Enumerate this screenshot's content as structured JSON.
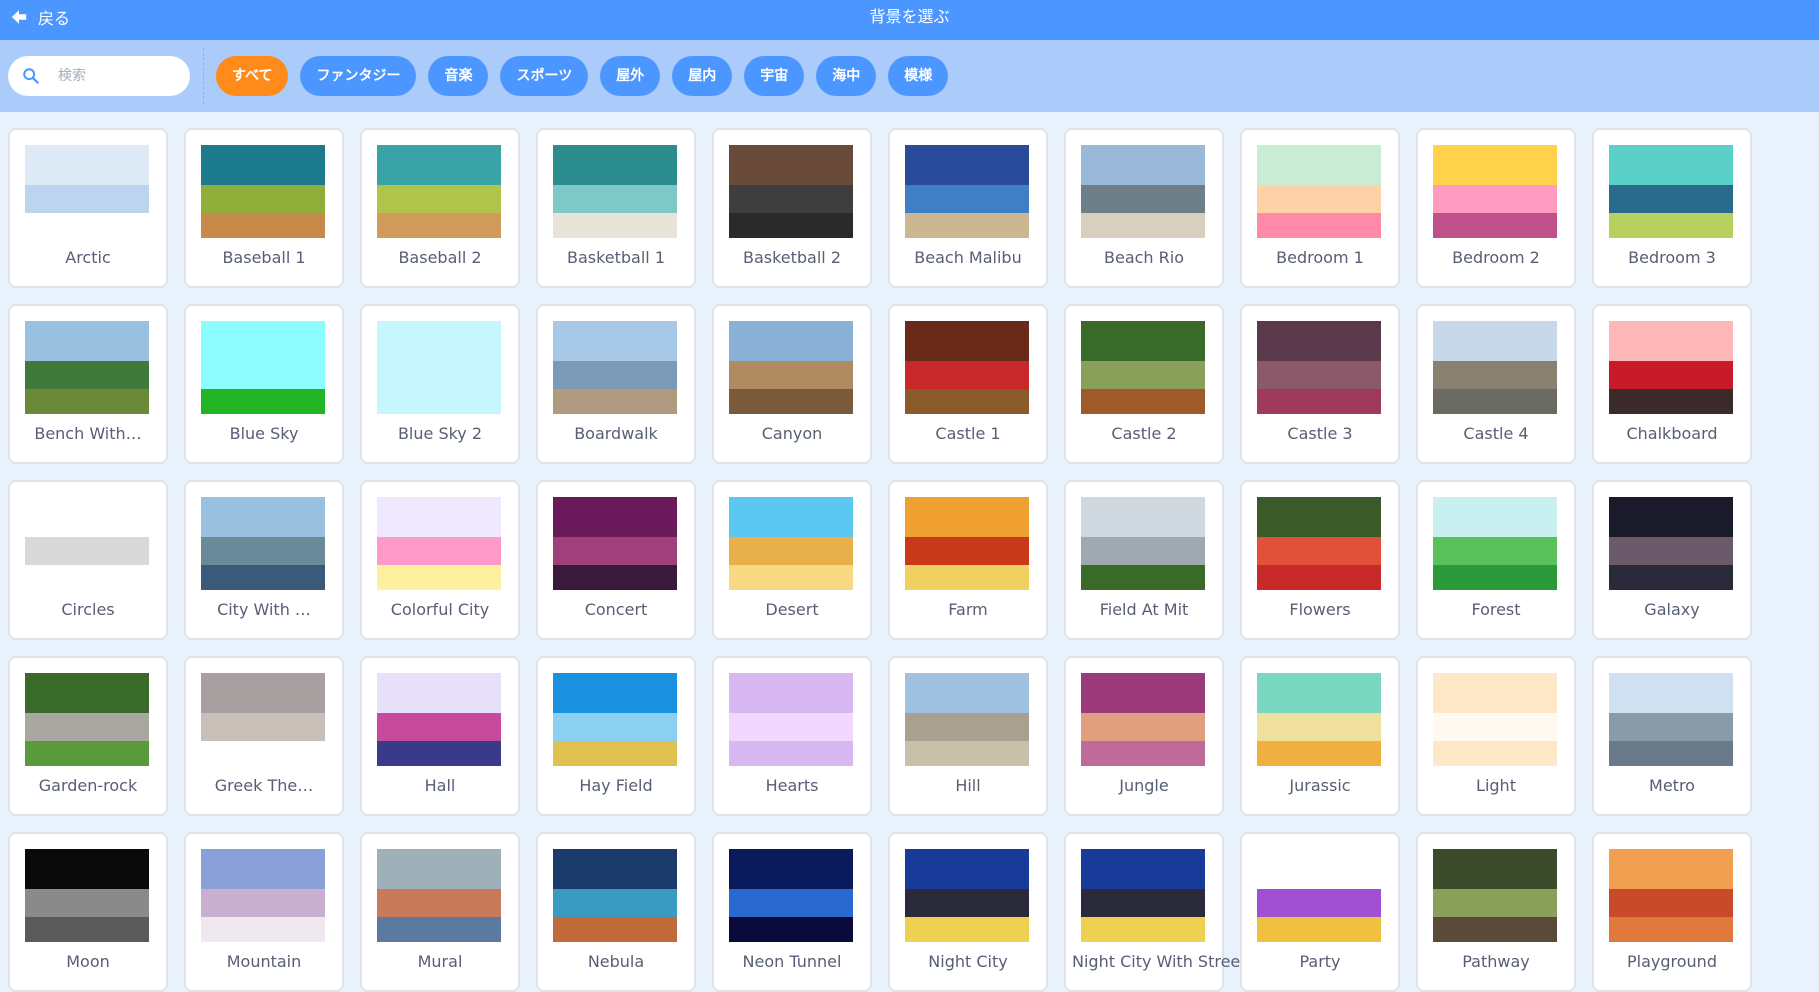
{
  "header": {
    "back_label": "戻る",
    "title": "背景を選ぶ"
  },
  "search": {
    "placeholder": "検索",
    "value": ""
  },
  "tags": [
    "すべて",
    "ファンタジー",
    "音楽",
    "スポーツ",
    "屋外",
    "屋内",
    "宇宙",
    "海中",
    "模様"
  ],
  "active_tag": 0,
  "colors": {
    "header": "#4c97ff",
    "filter_bar": "#abcbfa",
    "tag": "#4c97ff",
    "tag_active": "#ff8c1a",
    "background": "#e9f1fc"
  },
  "backdrops": [
    {
      "name": "Arctic",
      "colors": [
        "#dfeaf7",
        "#bcd4ee",
        "#ffffff"
      ]
    },
    {
      "name": "Baseball 1",
      "colors": [
        "#1b7a8c",
        "#8fae3a",
        "#c78a48"
      ]
    },
    {
      "name": "Baseball 2",
      "colors": [
        "#3aa3a8",
        "#b0c44a",
        "#d09a5a"
      ]
    },
    {
      "name": "Basketball 1",
      "colors": [
        "#2a8c8c",
        "#7ec8c8",
        "#e8e4d8"
      ]
    },
    {
      "name": "Basketball 2",
      "colors": [
        "#6a4a3a",
        "#3e3e3e",
        "#2a2a2a"
      ]
    },
    {
      "name": "Beach Malibu",
      "colors": [
        "#2a4a9a",
        "#3f7fc4",
        "#cbb892"
      ]
    },
    {
      "name": "Beach Rio",
      "colors": [
        "#9ab8d8",
        "#6f7f8a",
        "#d8cfbf"
      ]
    },
    {
      "name": "Bedroom 1",
      "colors": [
        "#c8ecd4",
        "#ffd1a8",
        "#ff8aa8"
      ]
    },
    {
      "name": "Bedroom 2",
      "colors": [
        "#ffd24a",
        "#ff9ac0",
        "#c0508a"
      ]
    },
    {
      "name": "Bedroom 3",
      "colors": [
        "#5ad0c8",
        "#2a6a8a",
        "#b8d060"
      ]
    },
    {
      "name": "Bench With…",
      "colors": [
        "#9ac0e0",
        "#3f7a3a",
        "#6a8a3a"
      ]
    },
    {
      "name": "Blue Sky",
      "colors": [
        "#8cfcff",
        "#8cfcff",
        "#22b422"
      ]
    },
    {
      "name": "Blue Sky 2",
      "colors": [
        "#c8f6ff",
        "#c8f6ff",
        "#c8f6ff"
      ]
    },
    {
      "name": "Boardwalk",
      "colors": [
        "#a8c8e8",
        "#7a9ab8",
        "#b09a80"
      ]
    },
    {
      "name": "Canyon",
      "colors": [
        "#8ab0d8",
        "#b08a60",
        "#7a5a3a"
      ]
    },
    {
      "name": "Castle 1",
      "colors": [
        "#6a2a1a",
        "#c8282a",
        "#8a5a2a"
      ]
    },
    {
      "name": "Castle 2",
      "colors": [
        "#3a6a2a",
        "#8aa05a",
        "#a05a2a"
      ]
    },
    {
      "name": "Castle 3",
      "colors": [
        "#5a3a4a",
        "#8a5a6a",
        "#a03a5a"
      ]
    },
    {
      "name": "Castle 4",
      "colors": [
        "#c8d8e8",
        "#8a8070",
        "#6a6a60"
      ]
    },
    {
      "name": "Chalkboard",
      "colors": [
        "#ffb8b8",
        "#c81a2a",
        "#3a2a2a"
      ]
    },
    {
      "name": "Circles",
      "colors": [
        "#ffffff",
        "#d8d8d8",
        "#ffffff"
      ]
    },
    {
      "name": "City With …",
      "colors": [
        "#9ac0e0",
        "#6a8a9a",
        "#3a5a7a"
      ]
    },
    {
      "name": "Colorful City",
      "colors": [
        "#f0e8ff",
        "#ff9ac8",
        "#fff0a0"
      ]
    },
    {
      "name": "Concert",
      "colors": [
        "#6a1a5a",
        "#a0407a",
        "#3a1a3a"
      ]
    },
    {
      "name": "Desert",
      "colors": [
        "#5ac8f0",
        "#e8b04a",
        "#f8d880"
      ]
    },
    {
      "name": "Farm",
      "colors": [
        "#f0a030",
        "#c83a1a",
        "#f0d060"
      ]
    },
    {
      "name": "Field At Mit",
      "colors": [
        "#d0d8e0",
        "#a0a8b0",
        "#3a6a2a"
      ]
    },
    {
      "name": "Flowers",
      "colors": [
        "#3a5a2a",
        "#e0503a",
        "#c82a2a"
      ]
    },
    {
      "name": "Forest",
      "colors": [
        "#c8f0f0",
        "#5ac05a",
        "#2a9a3a"
      ]
    },
    {
      "name": "Galaxy",
      "colors": [
        "#1a1a2a",
        "#6a5a6a",
        "#2a2a3a"
      ]
    },
    {
      "name": "Garden-rock",
      "colors": [
        "#3a6a2a",
        "#a8a8a0",
        "#5a9a3a"
      ]
    },
    {
      "name": "Greek The…",
      "colors": [
        "#a8a0a0",
        "#c8c0b8",
        "#ffffff"
      ]
    },
    {
      "name": "Hall",
      "colors": [
        "#e8e0f8",
        "#c84a9a",
        "#3a3a8a"
      ]
    },
    {
      "name": "Hay Field",
      "colors": [
        "#1a90e0",
        "#8ad0f0",
        "#e0c050"
      ]
    },
    {
      "name": "Hearts",
      "colors": [
        "#d8b8f0",
        "#f0d8ff",
        "#d8b8f0"
      ]
    },
    {
      "name": "Hill",
      "colors": [
        "#a0c0e0",
        "#a8a090",
        "#c8c0a8"
      ]
    },
    {
      "name": "Jungle",
      "colors": [
        "#9a3a7a",
        "#e0a080",
        "#c06a9a"
      ]
    },
    {
      "name": "Jurassic",
      "colors": [
        "#7ad8c0",
        "#f0e0a0",
        "#f0b040"
      ]
    },
    {
      "name": "Light",
      "colors": [
        "#ffe8c8",
        "#fffaf0",
        "#ffe8c8"
      ]
    },
    {
      "name": "Metro",
      "colors": [
        "#d0e0f0",
        "#8a9aa8",
        "#6a7a8a"
      ]
    },
    {
      "name": "Moon",
      "colors": [
        "#0a0a0a",
        "#8a8a8a",
        "#5a5a5a"
      ]
    },
    {
      "name": "Mountain",
      "colors": [
        "#8aa0d8",
        "#c8b0d0",
        "#f0e8f0"
      ]
    },
    {
      "name": "Mural",
      "colors": [
        "#a0b0b8",
        "#c87a5a",
        "#5a7aa0"
      ]
    },
    {
      "name": "Nebula",
      "colors": [
        "#1a3a6a",
        "#3a9ac0",
        "#c06a3a"
      ]
    },
    {
      "name": "Neon Tunnel",
      "colors": [
        "#0a1a5a",
        "#2a6ad0",
        "#0a0a3a"
      ]
    },
    {
      "name": "Night City",
      "colors": [
        "#1a3a9a",
        "#2a2a3a",
        "#f0d050"
      ]
    },
    {
      "name": "Night City With Street",
      "colors": [
        "#1a3a9a",
        "#2a2a3a",
        "#f0d050"
      ]
    },
    {
      "name": "Party",
      "colors": [
        "#ffffff",
        "#a050d0",
        "#f0c040"
      ]
    },
    {
      "name": "Pathway",
      "colors": [
        "#3a4a2a",
        "#8aa05a",
        "#5a4a3a"
      ]
    },
    {
      "name": "Playground",
      "colors": [
        "#f0a050",
        "#c84a2a",
        "#e07a3a"
      ]
    }
  ]
}
